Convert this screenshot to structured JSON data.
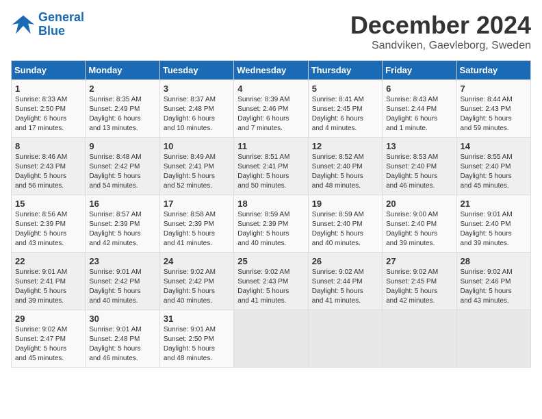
{
  "logo": {
    "line1": "General",
    "line2": "Blue"
  },
  "title": "December 2024",
  "subtitle": "Sandviken, Gaevleborg, Sweden",
  "days_of_week": [
    "Sunday",
    "Monday",
    "Tuesday",
    "Wednesday",
    "Thursday",
    "Friday",
    "Saturday"
  ],
  "weeks": [
    [
      {
        "day": "1",
        "info": "Sunrise: 8:33 AM\nSunset: 2:50 PM\nDaylight: 6 hours\nand 17 minutes."
      },
      {
        "day": "2",
        "info": "Sunrise: 8:35 AM\nSunset: 2:49 PM\nDaylight: 6 hours\nand 13 minutes."
      },
      {
        "day": "3",
        "info": "Sunrise: 8:37 AM\nSunset: 2:48 PM\nDaylight: 6 hours\nand 10 minutes."
      },
      {
        "day": "4",
        "info": "Sunrise: 8:39 AM\nSunset: 2:46 PM\nDaylight: 6 hours\nand 7 minutes."
      },
      {
        "day": "5",
        "info": "Sunrise: 8:41 AM\nSunset: 2:45 PM\nDaylight: 6 hours\nand 4 minutes."
      },
      {
        "day": "6",
        "info": "Sunrise: 8:43 AM\nSunset: 2:44 PM\nDaylight: 6 hours\nand 1 minute."
      },
      {
        "day": "7",
        "info": "Sunrise: 8:44 AM\nSunset: 2:43 PM\nDaylight: 5 hours\nand 59 minutes."
      }
    ],
    [
      {
        "day": "8",
        "info": "Sunrise: 8:46 AM\nSunset: 2:43 PM\nDaylight: 5 hours\nand 56 minutes."
      },
      {
        "day": "9",
        "info": "Sunrise: 8:48 AM\nSunset: 2:42 PM\nDaylight: 5 hours\nand 54 minutes."
      },
      {
        "day": "10",
        "info": "Sunrise: 8:49 AM\nSunset: 2:41 PM\nDaylight: 5 hours\nand 52 minutes."
      },
      {
        "day": "11",
        "info": "Sunrise: 8:51 AM\nSunset: 2:41 PM\nDaylight: 5 hours\nand 50 minutes."
      },
      {
        "day": "12",
        "info": "Sunrise: 8:52 AM\nSunset: 2:40 PM\nDaylight: 5 hours\nand 48 minutes."
      },
      {
        "day": "13",
        "info": "Sunrise: 8:53 AM\nSunset: 2:40 PM\nDaylight: 5 hours\nand 46 minutes."
      },
      {
        "day": "14",
        "info": "Sunrise: 8:55 AM\nSunset: 2:40 PM\nDaylight: 5 hours\nand 45 minutes."
      }
    ],
    [
      {
        "day": "15",
        "info": "Sunrise: 8:56 AM\nSunset: 2:39 PM\nDaylight: 5 hours\nand 43 minutes."
      },
      {
        "day": "16",
        "info": "Sunrise: 8:57 AM\nSunset: 2:39 PM\nDaylight: 5 hours\nand 42 minutes."
      },
      {
        "day": "17",
        "info": "Sunrise: 8:58 AM\nSunset: 2:39 PM\nDaylight: 5 hours\nand 41 minutes."
      },
      {
        "day": "18",
        "info": "Sunrise: 8:59 AM\nSunset: 2:39 PM\nDaylight: 5 hours\nand 40 minutes."
      },
      {
        "day": "19",
        "info": "Sunrise: 8:59 AM\nSunset: 2:40 PM\nDaylight: 5 hours\nand 40 minutes."
      },
      {
        "day": "20",
        "info": "Sunrise: 9:00 AM\nSunset: 2:40 PM\nDaylight: 5 hours\nand 39 minutes."
      },
      {
        "day": "21",
        "info": "Sunrise: 9:01 AM\nSunset: 2:40 PM\nDaylight: 5 hours\nand 39 minutes."
      }
    ],
    [
      {
        "day": "22",
        "info": "Sunrise: 9:01 AM\nSunset: 2:41 PM\nDaylight: 5 hours\nand 39 minutes."
      },
      {
        "day": "23",
        "info": "Sunrise: 9:01 AM\nSunset: 2:42 PM\nDaylight: 5 hours\nand 40 minutes."
      },
      {
        "day": "24",
        "info": "Sunrise: 9:02 AM\nSunset: 2:42 PM\nDaylight: 5 hours\nand 40 minutes."
      },
      {
        "day": "25",
        "info": "Sunrise: 9:02 AM\nSunset: 2:43 PM\nDaylight: 5 hours\nand 41 minutes."
      },
      {
        "day": "26",
        "info": "Sunrise: 9:02 AM\nSunset: 2:44 PM\nDaylight: 5 hours\nand 41 minutes."
      },
      {
        "day": "27",
        "info": "Sunrise: 9:02 AM\nSunset: 2:45 PM\nDaylight: 5 hours\nand 42 minutes."
      },
      {
        "day": "28",
        "info": "Sunrise: 9:02 AM\nSunset: 2:46 PM\nDaylight: 5 hours\nand 43 minutes."
      }
    ],
    [
      {
        "day": "29",
        "info": "Sunrise: 9:02 AM\nSunset: 2:47 PM\nDaylight: 5 hours\nand 45 minutes."
      },
      {
        "day": "30",
        "info": "Sunrise: 9:01 AM\nSunset: 2:48 PM\nDaylight: 5 hours\nand 46 minutes."
      },
      {
        "day": "31",
        "info": "Sunrise: 9:01 AM\nSunset: 2:50 PM\nDaylight: 5 hours\nand 48 minutes."
      },
      null,
      null,
      null,
      null
    ]
  ]
}
